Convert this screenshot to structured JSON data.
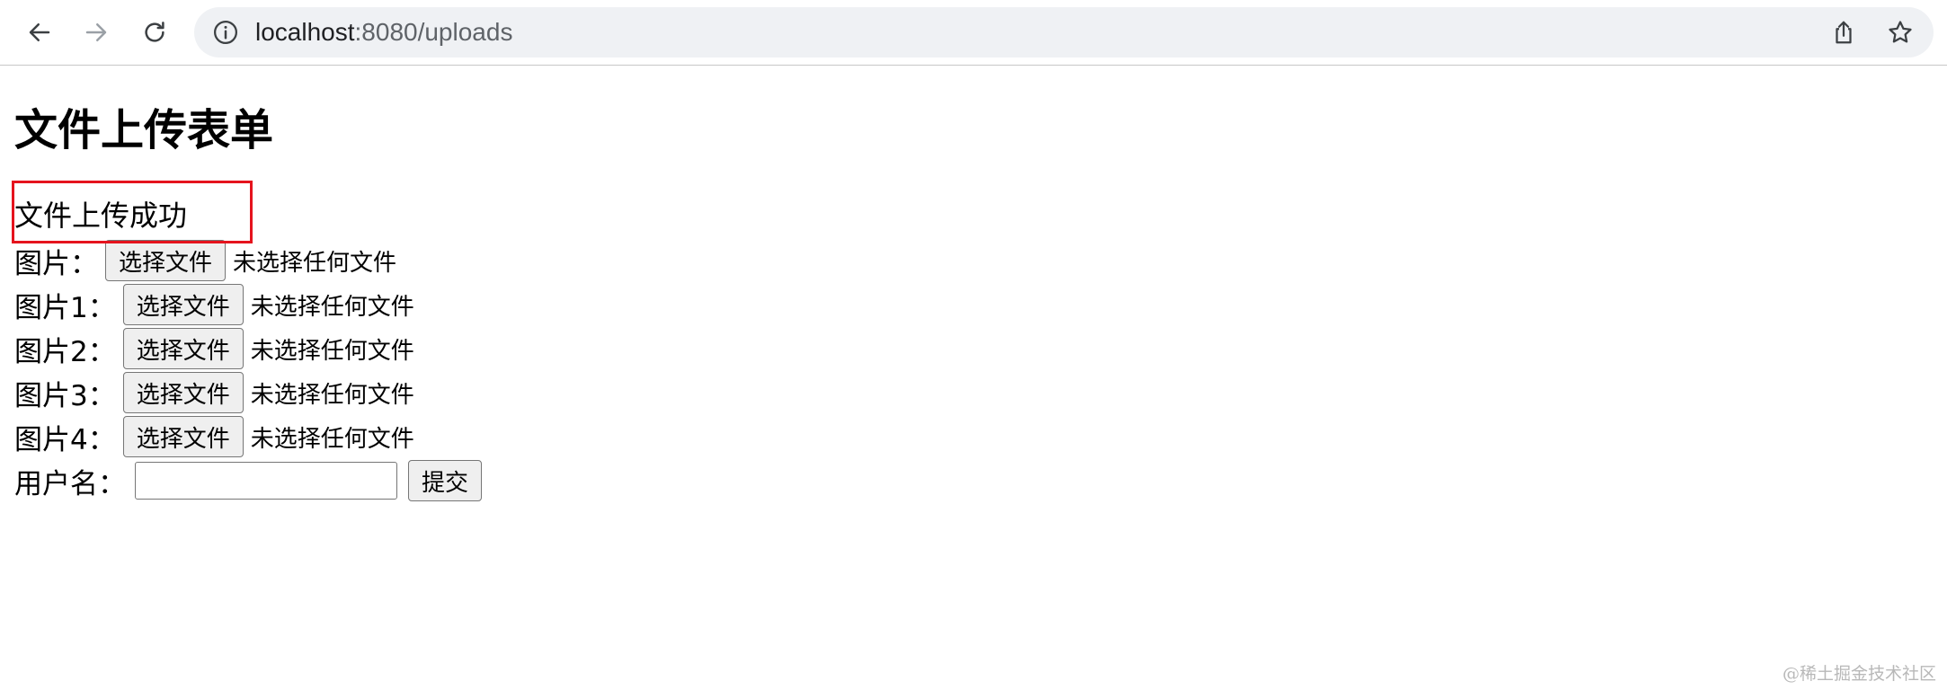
{
  "browser": {
    "url_host": "localhost",
    "url_rest": ":8080/uploads",
    "icons": {
      "back": "arrow-left-icon",
      "forward": "arrow-right-icon",
      "reload": "reload-icon",
      "info": "info-icon",
      "share": "share-icon",
      "bookmark": "star-icon"
    }
  },
  "page": {
    "title": "文件上传表单",
    "success_message": "文件上传成功",
    "highlight_color": "#e5131d",
    "file_rows": [
      {
        "label": "图片：",
        "button": "选择文件",
        "status": "未选择任何文件"
      },
      {
        "label": "图片1：",
        "button": "选择文件",
        "status": "未选择任何文件"
      },
      {
        "label": "图片2：",
        "button": "选择文件",
        "status": "未选择任何文件"
      },
      {
        "label": "图片3：",
        "button": "选择文件",
        "status": "未选择任何文件"
      },
      {
        "label": "图片4：",
        "button": "选择文件",
        "status": "未选择任何文件"
      }
    ],
    "username_label": "用户名：",
    "username_value": "",
    "submit_label": "提交"
  },
  "watermark": "@稀土掘金技术社区"
}
